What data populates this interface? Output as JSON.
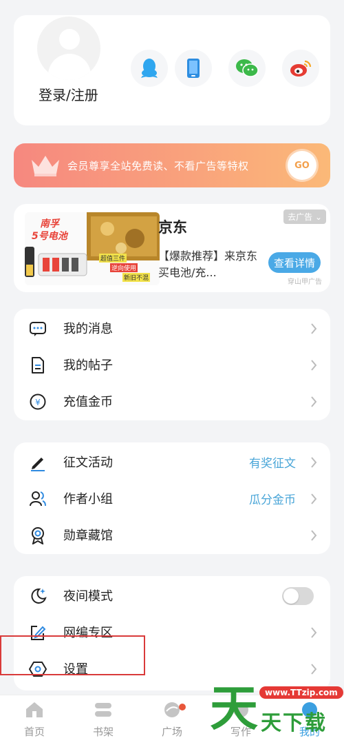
{
  "profile": {
    "login_label": "登录/注册",
    "social_icons": [
      "qq-icon",
      "phone-icon",
      "wechat-icon",
      "weibo-icon"
    ]
  },
  "vip": {
    "text": "会员尊享全站免费读、不看广告等特权",
    "go_label": "GO"
  },
  "ad": {
    "title": "京东",
    "description": "【爆款推荐】来京东买电池/充...",
    "close_label": "去广告",
    "cta_label": "查看详情",
    "source_label": "穿山甲广告",
    "image_text": {
      "brand": "南孚",
      "product": "5号电池",
      "tag1": "超值三件",
      "tag2": "逆向使用",
      "tag3": "新旧不混"
    }
  },
  "menu": {
    "group1": [
      {
        "label": "我的消息",
        "icon": "message-icon"
      },
      {
        "label": "我的帖子",
        "icon": "document-icon"
      },
      {
        "label": "充值金币",
        "icon": "coin-icon"
      }
    ],
    "group2": [
      {
        "label": "征文活动",
        "extra": "有奖征文",
        "icon": "pen-icon"
      },
      {
        "label": "作者小组",
        "extra": "瓜分金币",
        "icon": "group-icon"
      },
      {
        "label": "勋章藏馆",
        "icon": "medal-icon"
      }
    ],
    "group3": [
      {
        "label": "夜间模式",
        "icon": "moon-icon",
        "toggle": false
      },
      {
        "label": "网编专区",
        "icon": "edit-icon"
      },
      {
        "label": "设置",
        "icon": "settings-icon"
      }
    ]
  },
  "tabs": [
    {
      "label": "首页",
      "icon": "home-icon"
    },
    {
      "label": "书架",
      "icon": "bookshelf-icon"
    },
    {
      "label": "广场",
      "icon": "square-icon"
    },
    {
      "label": "写作",
      "icon": "write-icon"
    },
    {
      "label": "我的",
      "icon": "profile-icon",
      "active": true
    }
  ],
  "watermark": {
    "url": "www.TTzip.com",
    "big": "天",
    "small": "天下载"
  },
  "colors": {
    "accent": "#4aa6d8",
    "vip_start": "#f6887f",
    "vip_end": "#fbb978",
    "highlight_box": "#d93a3a",
    "watermark_green": "#2e9d3a"
  }
}
